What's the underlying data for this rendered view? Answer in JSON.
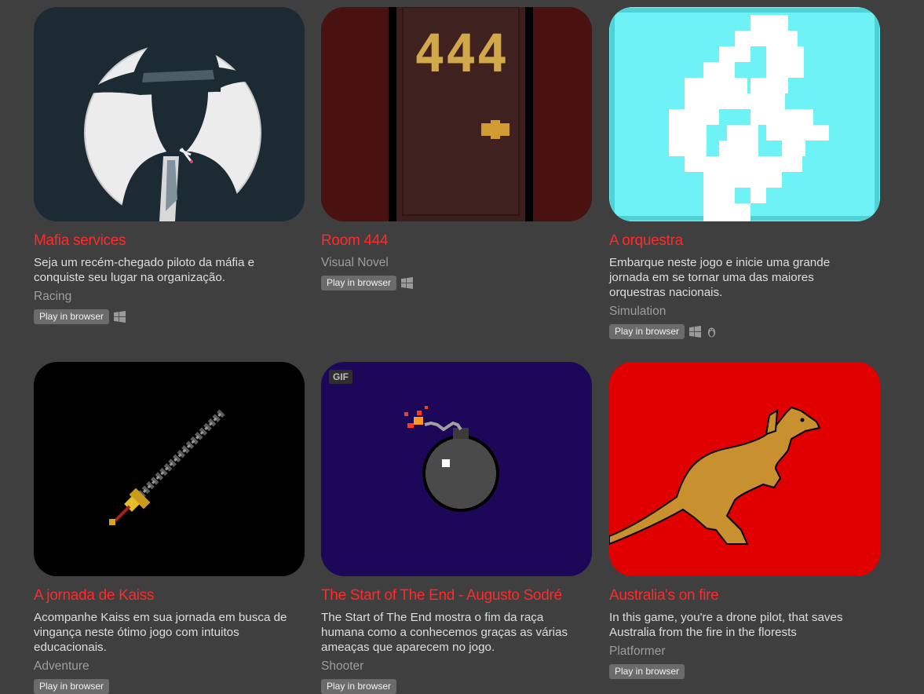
{
  "games": [
    {
      "title": "Mafia services",
      "description": "Seja um recém-chegado piloto da máfia e conquiste seu lugar na organização.",
      "genre": "Racing",
      "badge": "Play in browser",
      "platforms": [
        "windows"
      ]
    },
    {
      "title": "Room 444",
      "description": "",
      "genre": "Visual Novel",
      "badge": "Play in browser",
      "platforms": [
        "windows"
      ],
      "door_number": "444"
    },
    {
      "title": "A orquestra",
      "description": "Embarque neste jogo e inicie uma grande jornada em se tornar uma das maiores orquestras nacionais.",
      "genre": "Simulation",
      "badge": "Play in browser",
      "platforms": [
        "windows",
        "linux"
      ]
    },
    {
      "title": "A jornada de Kaiss",
      "description": "Acompanhe Kaiss em sua jornada em busca de vingança neste ótimo jogo com intuitos educacionais.",
      "genre": "Adventure",
      "badge": "Play in browser",
      "platforms": []
    },
    {
      "title": "The Start of The End - Augusto Sodré",
      "description": "The Start of The End mostra o fim da raça humana como a conhecemos graças as várias ameaças que aparecem no jogo.",
      "genre": "Shooter",
      "badge": "Play in browser",
      "platforms": [],
      "gif_label": "GIF"
    },
    {
      "title": "Australia's on fire",
      "description": "In this game, you're a drone pilot, that saves Australia from the fire in the florests",
      "genre": "Platformer",
      "badge": "Play in browser",
      "platforms": []
    }
  ],
  "colors": {
    "background": "#3f3f3f",
    "title": "#ff2a2a",
    "badge": "#6b6b6b"
  }
}
